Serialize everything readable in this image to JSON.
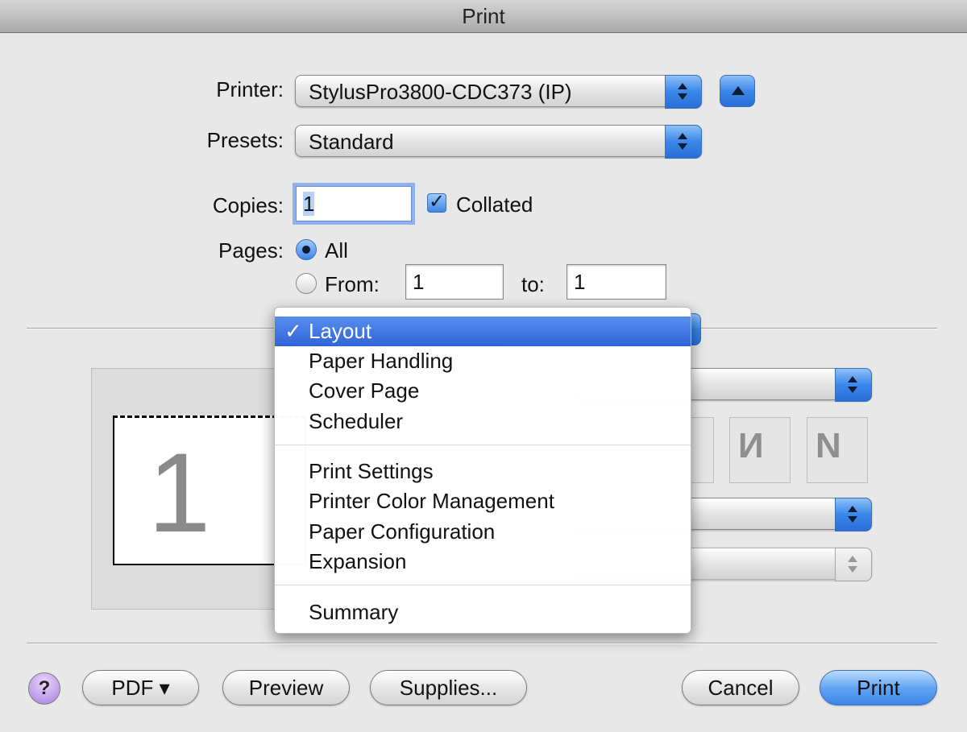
{
  "window": {
    "title": "Print"
  },
  "printer": {
    "label": "Printer:",
    "value": "StylusPro3800-CDC373 (IP)"
  },
  "presets": {
    "label": "Presets:",
    "value": "Standard"
  },
  "copies": {
    "label": "Copies:",
    "value": "1",
    "collated_label": "Collated",
    "collated_checked": true
  },
  "pages": {
    "label": "Pages:",
    "all_label": "All",
    "all_selected": true,
    "from_label": "From:",
    "from_value": "1",
    "to_label": "to:",
    "to_value": "1"
  },
  "preview": {
    "page_number": "1"
  },
  "panel_menu": {
    "selected": "Layout",
    "check_mark": "✓",
    "groups": [
      [
        "Layout",
        "Paper Handling",
        "Cover Page",
        "Scheduler"
      ],
      [
        "Print Settings",
        "Printer Color Management",
        "Paper Configuration",
        "Expansion"
      ],
      [
        "Summary"
      ]
    ]
  },
  "buttons": {
    "help": "?",
    "pdf": "PDF ▾",
    "preview": "Preview",
    "supplies": "Supplies...",
    "cancel": "Cancel",
    "print": "Print"
  },
  "colors": {
    "accent": "#3a86e8",
    "menu_highlight": "#3a6fdc"
  }
}
